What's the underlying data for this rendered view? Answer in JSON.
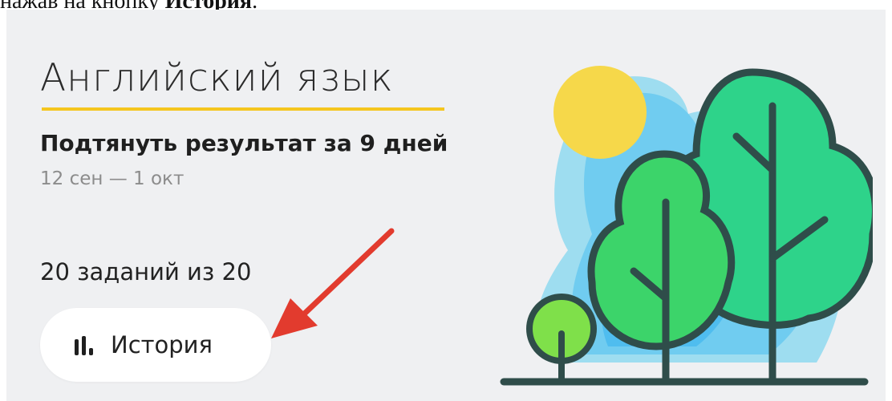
{
  "caption": {
    "prefix": "нажав на кнопку ",
    "bold": "История",
    "suffix": "."
  },
  "card": {
    "subject": "Английский язык",
    "goal": "Подтянуть результат за 9 дней",
    "dates": "12 сен — 1 окт",
    "progress": "20 заданий из 20",
    "history_button": {
      "label": "История",
      "icon": "bar-chart-icon"
    }
  },
  "annotation": {
    "icon": "red-arrow-icon",
    "color": "#e23b2e"
  },
  "illustration": {
    "icon": "trees-with-sun-illustration"
  },
  "colors": {
    "card_bg": "#eff0f2",
    "underline": "#f5c61f",
    "sun": "#f6d84a",
    "tree_light": "#7fe04a",
    "tree_mid": "#3cd46a",
    "tree_dark": "#2ed38a",
    "outline": "#2f4d4a"
  }
}
